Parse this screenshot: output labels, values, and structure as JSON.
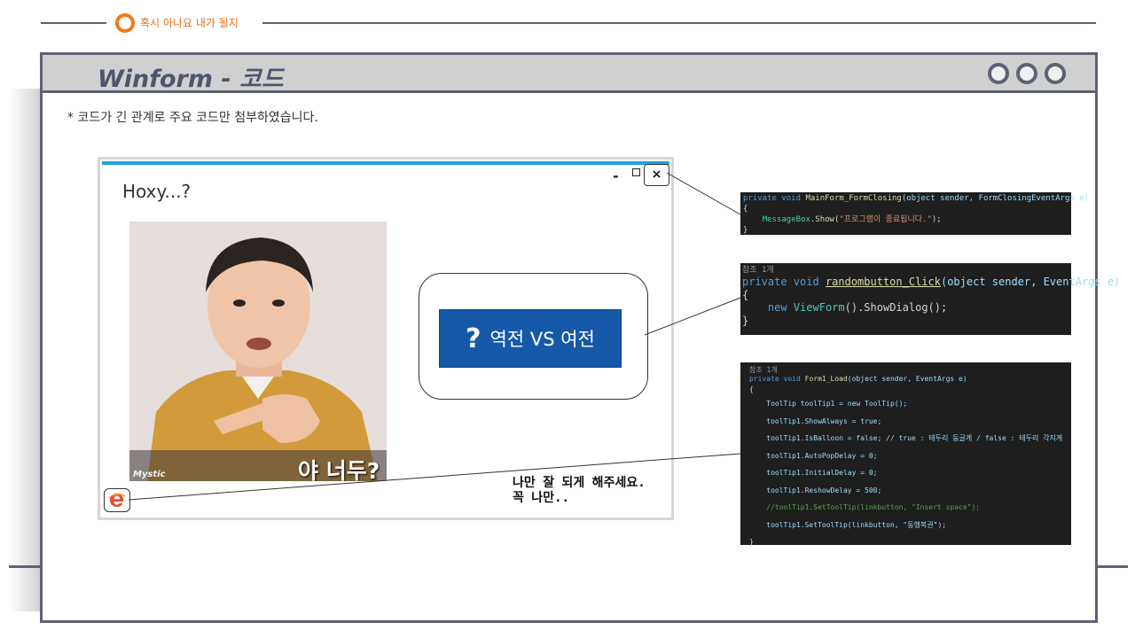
{
  "header": {
    "title": "혹시 아나요 내가 될지"
  },
  "window": {
    "title": "Winform - 코드",
    "dots": [
      "dot",
      "dot",
      "dot"
    ]
  },
  "note": "* 코드가 긴 관계로 주요 코드만 첨부하였습니다.",
  "winform": {
    "title": "Hoxy...?",
    "min_label": "-",
    "close_label": "×",
    "photo": {
      "watermark": "Mystic",
      "caption": "야 너두?"
    },
    "random_button": {
      "icon": "?",
      "label": "역전 VS 여전"
    },
    "hint_line1": "나만 잘 되게 해주세요.",
    "hint_line2": "꼭 나만..",
    "link_icon": "internet-explorer-icon"
  },
  "code_panels": {
    "closing": {
      "line1": {
        "kw": "private void",
        "fn": "MainForm_FormClosing",
        "args": "(object sender, FormClosingEventArgs e)"
      },
      "open": "{",
      "body": {
        "obj": "MessageBox",
        "call": ".Show(",
        "str": "\"프로그램이 종료됩니다.\"",
        "end": ");"
      },
      "close": "}"
    },
    "random": {
      "ref": "참조 1개",
      "line1": {
        "kw": "private void",
        "fn": "randombutton_Click",
        "args": "(object sender, EventArgs e)"
      },
      "open": "{",
      "body": {
        "kw": "new",
        "ty": "ViewForm",
        "rest": "().ShowDialog();"
      },
      "close": "}"
    },
    "load": {
      "ref": "참조 1개",
      "line1": {
        "kw": "private void",
        "fn": "Form1_Load",
        "args": "(object sender, EventArgs e)"
      },
      "open": "{",
      "lines": [
        "ToolTip toolTip1 = new ToolTip();",
        "toolTip1.ShowAlways = true;",
        "toolTip1.IsBalloon = false; // true : 테두리 둥글게 / false : 테두리 각지게",
        "toolTip1.AutoPopDelay = 0;",
        "toolTip1.InitialDelay = 0;",
        "toolTip1.ReshowDelay = 500;",
        "//toolTip1.SetToolTip(linkbutton, \"Insert space\");",
        "toolTip1.SetToolTip(linkbutton, \"동행복권\");"
      ],
      "close": "}"
    }
  },
  "colors": {
    "accent": "#f0791c",
    "frame": "#5d6275",
    "button": "#1659a9",
    "title_bar": "#1da3df",
    "code_bg": "#1e1e1e"
  }
}
